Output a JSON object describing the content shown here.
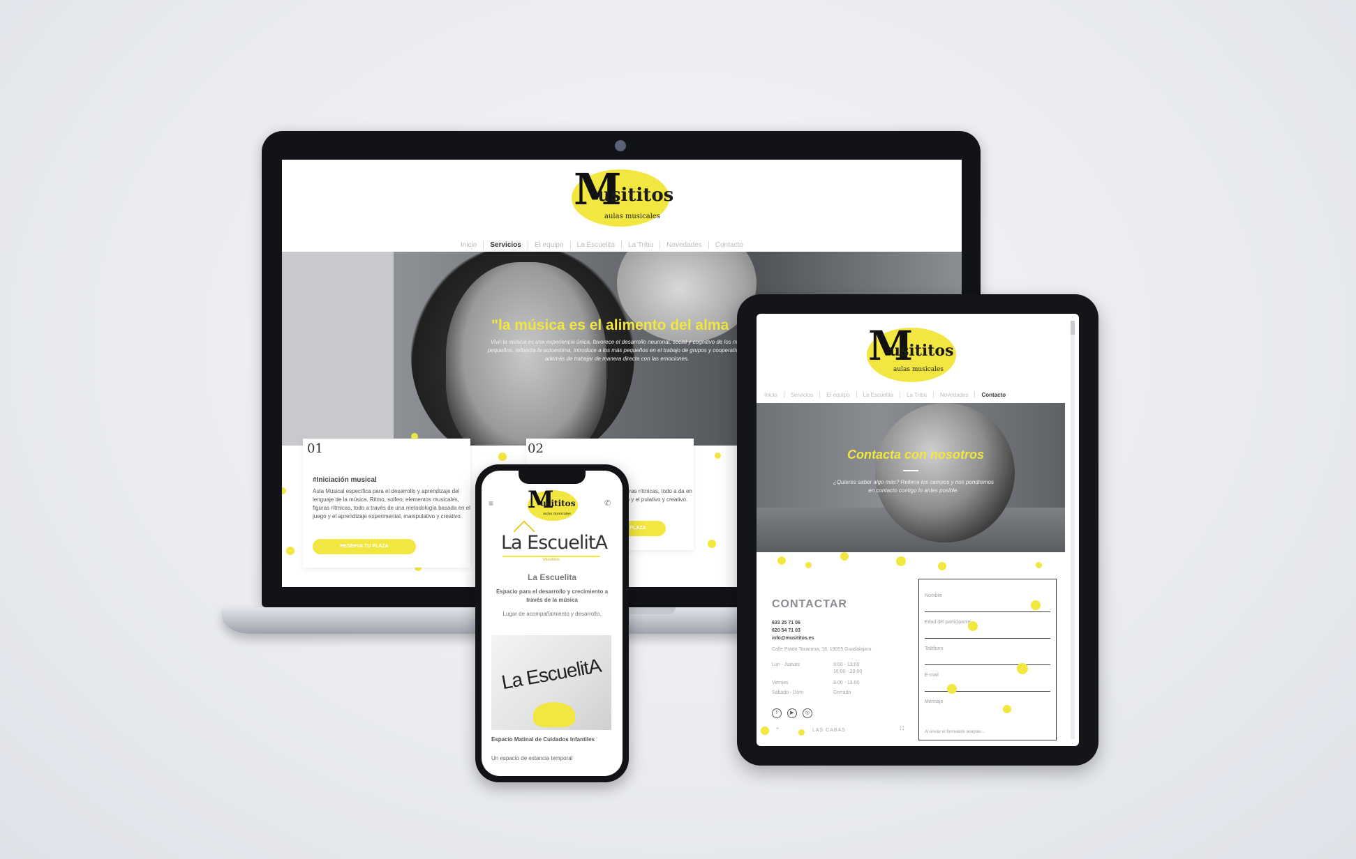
{
  "colors": {
    "accent_yellow": "#f2e640",
    "dark_device": "#121316",
    "text_gray": "#555555"
  },
  "brand": {
    "name": "usititos",
    "clef_letter": "M",
    "tagline": "aulas musicales"
  },
  "laptop": {
    "nav": {
      "items": [
        "Inicio",
        "Servicios",
        "El equipo",
        "La Escuelita",
        "La Tribu",
        "Novedades",
        "Contacto"
      ],
      "active": "Servicios"
    },
    "hero": {
      "quote": "\"la música es el alimento del alma",
      "text": "Vivir la música es una experiencia única, favorece el desarrollo neuronal, social y cognitivo de los más pequeños, refuerza la autoestima, introduce a los más pequeños en el trabajo de grupos y cooperativo... además de trabajar de manera directa con las emociones."
    },
    "services": [
      {
        "number": "01",
        "title": "#Iniciación musical",
        "text": "Aula Musical específica para el desarrollo y aprendizaje del lenguaje de la música. Ritmo, solfeo, elementos musicales, figuras rítmicas, todo a través de una metodología basada en el juego y el aprendizaje experimental, manipulativo y creativo.",
        "button": "RESERVA TU PLAZA"
      },
      {
        "number": "02",
        "text": "les, figuras rítmicas, todo a da en el juego y el pulativo y creativo.",
        "button": "PLAZA"
      }
    ]
  },
  "tablet": {
    "nav": {
      "items": [
        "Inicio",
        "Servicios",
        "El equipo",
        "La Escuelita",
        "La Tribu",
        "Novedades",
        "Contacto"
      ],
      "active": "Contacto"
    },
    "hero": {
      "title": "Contacta con nosotros",
      "subtitle": "¿Quieres saber algo más? Rellena los campos y nos pondremos en contacto contigo lo antes posible."
    },
    "contact": {
      "title": "CONTACTAR",
      "phone1": "633 25 71 06",
      "phone2": "620 54 71 03",
      "email": "info@musititos.es",
      "address": "Calle Prado Taracena, 18, 19005 Guadalajara",
      "hours": [
        {
          "day": "Lun - Jueves",
          "time": "9:00 - 13:00"
        },
        {
          "day": "",
          "time": "16:00 - 20:00"
        },
        {
          "day": "Viernes",
          "time": "9:00 - 13:00"
        },
        {
          "day": "Sábado - Dom",
          "time": "Cerrado"
        }
      ],
      "social": [
        "f",
        "▶",
        "◎"
      ],
      "footer": "LAS CABAS"
    },
    "form": {
      "fields": [
        "Nombre",
        "Edad del participante",
        "Teléfono",
        "E-mail",
        "Mensaje"
      ],
      "consent": "Al enviar el formulario aceptas..."
    }
  },
  "phone": {
    "escuelita_logo": "La EscuelitA",
    "escuelita_sub": "Musititos",
    "title": "La Escuelita",
    "text1": "Espacio para el desarrollo y crecimiento a través de la música",
    "text2": "Lugar de acompañamiento y desarrollo.",
    "image_logo": "La EscuelitA",
    "section_title": "Espacio Matinal de Cuidados Infantiles",
    "section_text": "Un espacio de estancia temporal"
  }
}
